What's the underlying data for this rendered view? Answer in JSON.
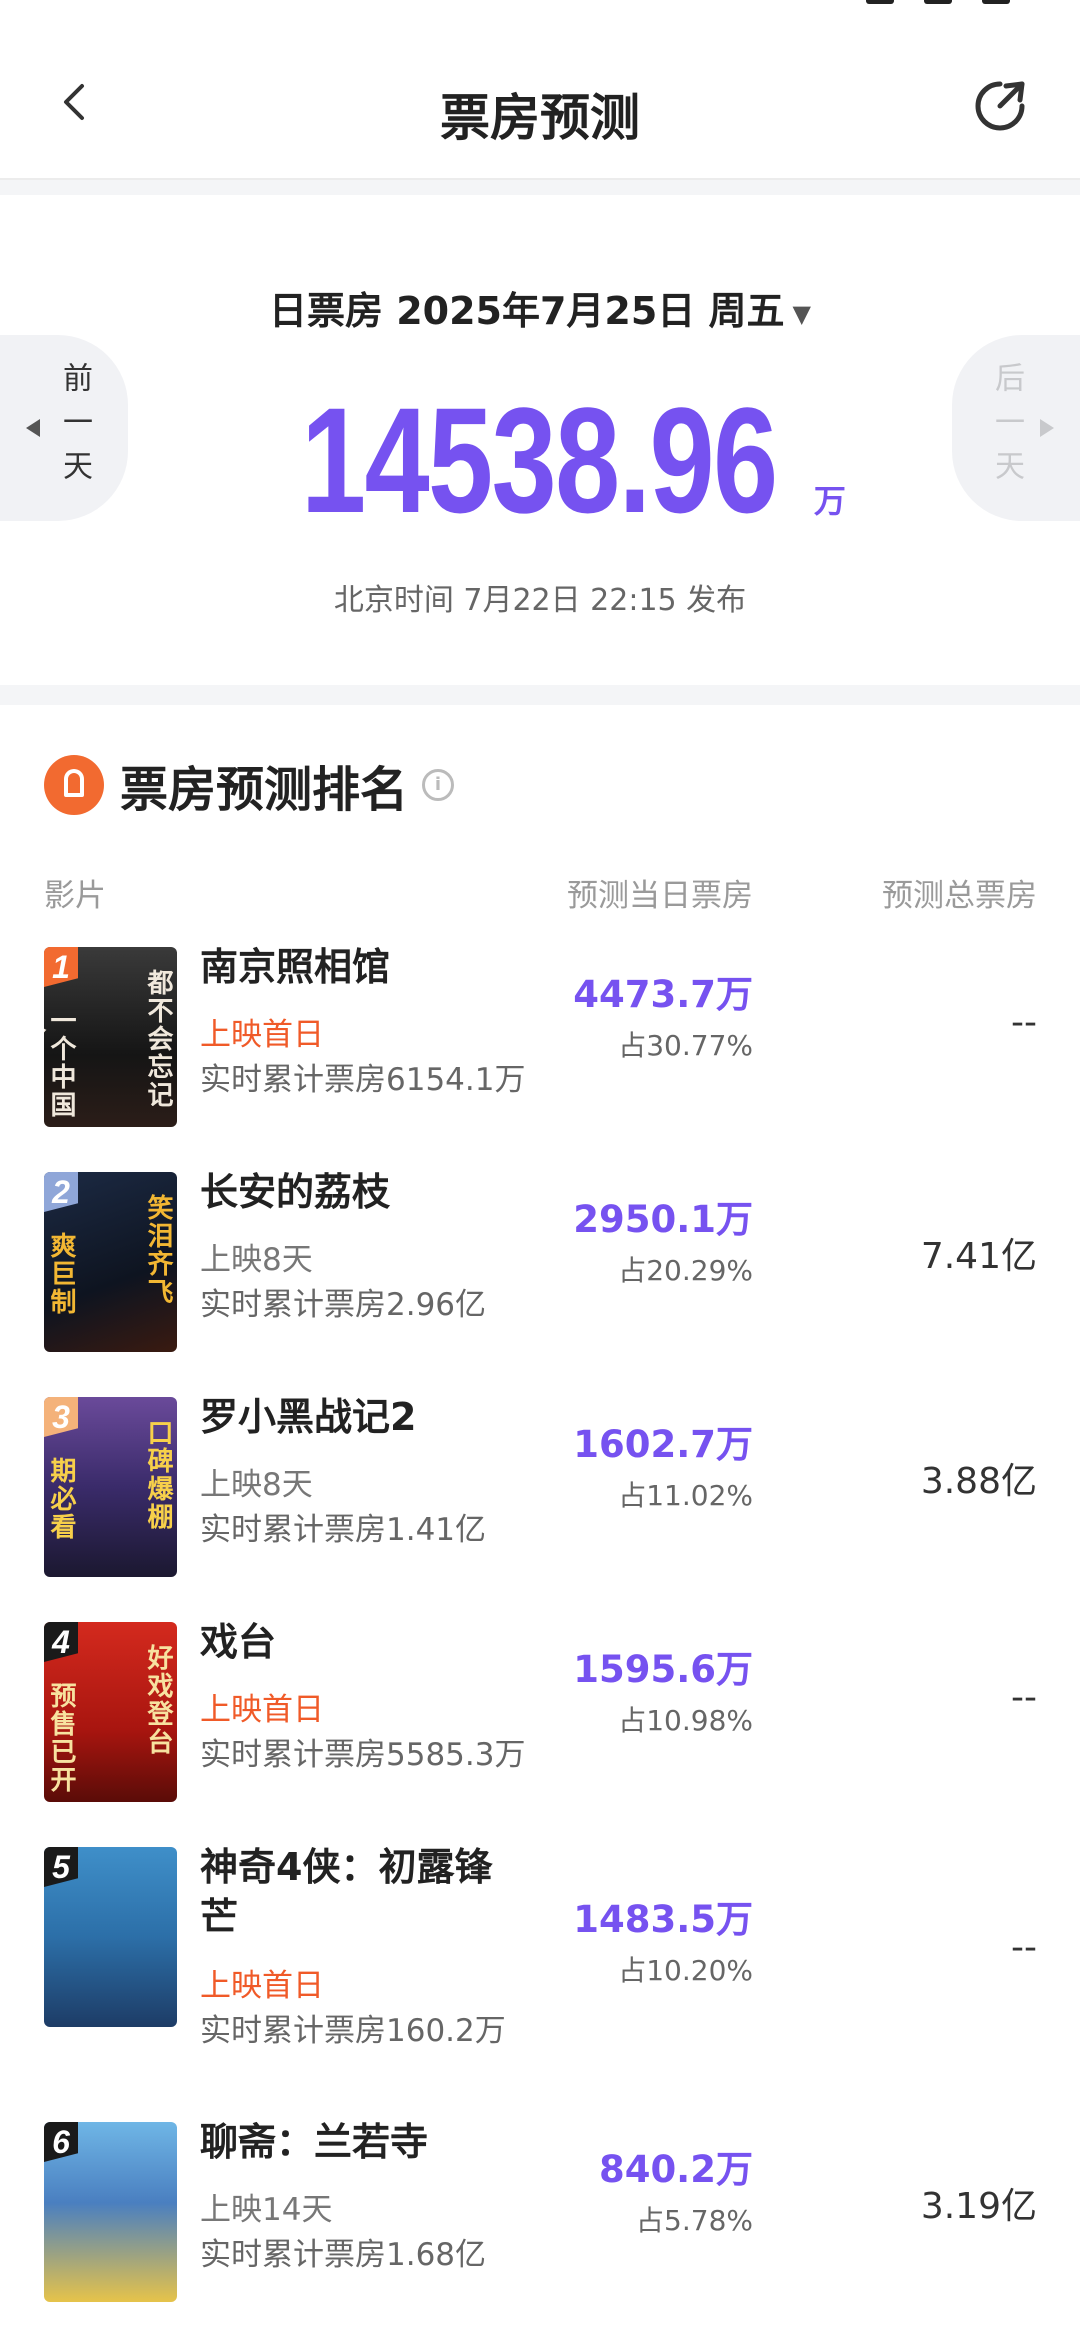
{
  "nav": {
    "title": "票房预测"
  },
  "summary": {
    "date_label": "日票房 2025年7月25日 周五",
    "prev_label": "前一天",
    "next_label": "后一天",
    "total_value": "14538.96",
    "total_unit": "万",
    "publish_time": "北京时间 7月22日 22:15 发布"
  },
  "ranking": {
    "title": "票房预测排名",
    "col_film": "影片",
    "col_daily": "预测当日票房",
    "col_total": "预测总票房",
    "movies": [
      {
        "rank": "1",
        "name": "南京照相馆",
        "days": "上映首日",
        "cumulative": "实时累计票房6154.1万",
        "daily": "4473.7万",
        "share": "占30.77%",
        "total": "--",
        "poster_caption": "都不会忘记",
        "poster_caption_left": "一个中国人"
      },
      {
        "rank": "2",
        "name": "长安的荔枝",
        "days": "上映8天",
        "cumulative": "实时累计票房2.96亿",
        "daily": "2950.1万",
        "share": "占20.29%",
        "total": "7.41亿",
        "poster_caption": "笑泪齐飞",
        "poster_caption_left": "爽巨制"
      },
      {
        "rank": "3",
        "name": "罗小黑战记2",
        "days": "上映8天",
        "cumulative": "实时累计票房1.41亿",
        "daily": "1602.7万",
        "share": "占11.02%",
        "total": "3.88亿",
        "poster_caption": "口碑爆棚",
        "poster_caption_left": "期必看"
      },
      {
        "rank": "4",
        "name": "戏台",
        "days": "上映首日",
        "cumulative": "实时累计票房5585.3万",
        "daily": "1595.6万",
        "share": "占10.98%",
        "total": "--",
        "poster_caption": "好戏登台",
        "poster_caption_left": "预售已开"
      },
      {
        "rank": "5",
        "name": "神奇4侠：初露锋芒",
        "days": "上映首日",
        "cumulative": "实时累计票房160.2万",
        "daily": "1483.5万",
        "share": "占10.20%",
        "total": "--",
        "poster_caption": "",
        "poster_caption_left": ""
      },
      {
        "rank": "6",
        "name": "聊斋：兰若寺",
        "days": "上映14天",
        "cumulative": "实时累计票房1.68亿",
        "daily": "840.2万",
        "share": "占5.78%",
        "total": "3.19亿",
        "poster_caption": "",
        "poster_caption_left": ""
      }
    ]
  },
  "colors": {
    "accent_purple": "#7652f0",
    "first_day_orange": "#f05a28",
    "rank_badges": [
      "#f26a30",
      "#8fa6d8",
      "#f4b27a",
      "#1a1a1a",
      "#1a1a1a",
      "#1a1a1a"
    ]
  },
  "icons": {
    "back": "chevron-left-icon",
    "share": "share-arrow-icon",
    "rank_logo": "lighthouse-logo-icon",
    "info": "info-icon",
    "dropdown": "caret-down-icon"
  }
}
